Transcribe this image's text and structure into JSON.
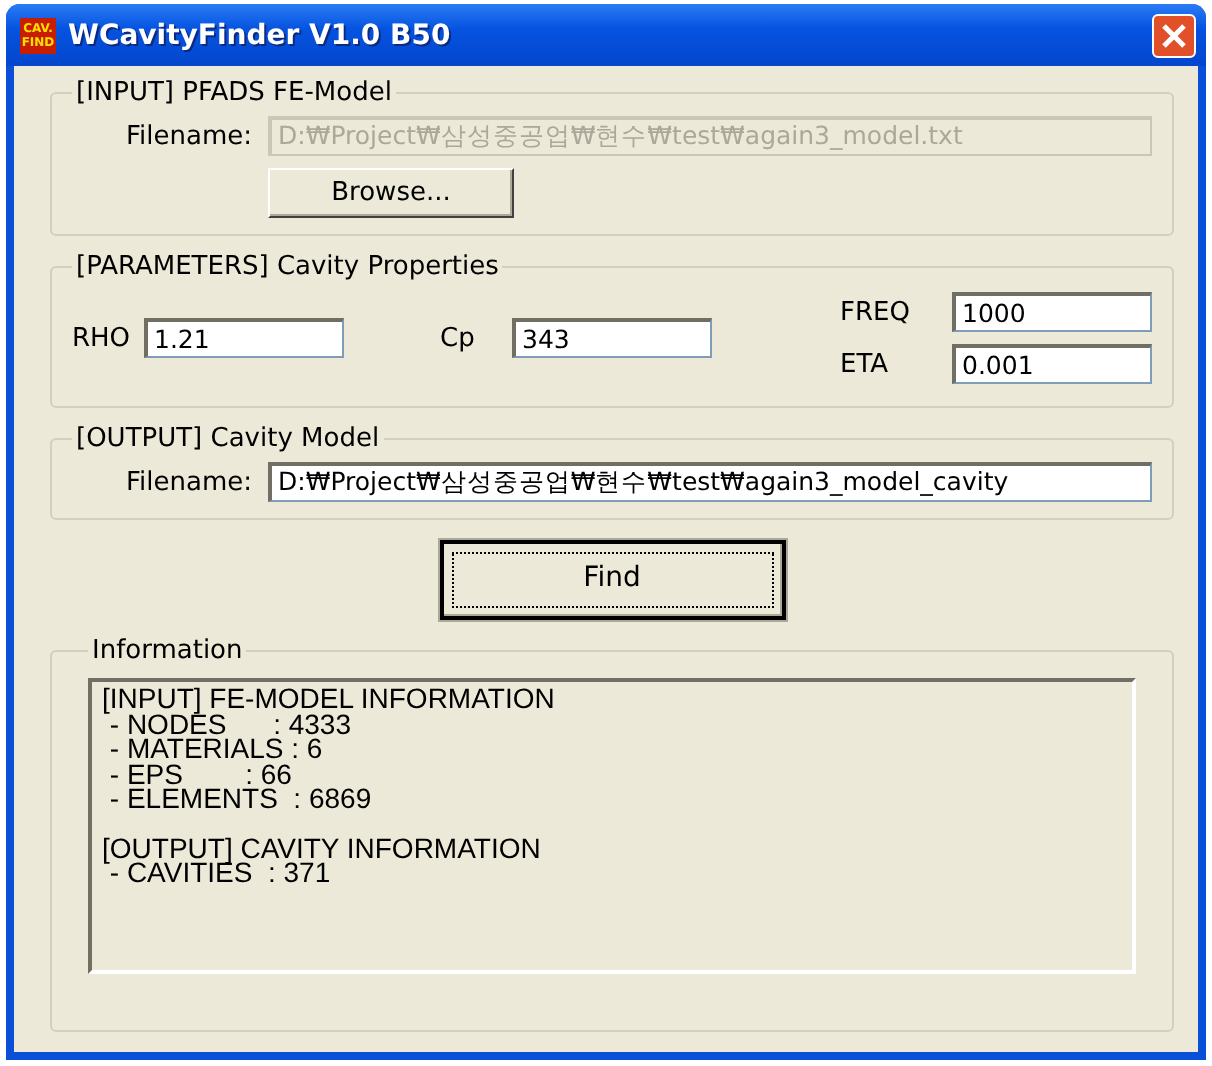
{
  "window": {
    "title": "WCavityFinder V1.0 B50",
    "icon_text": [
      "CAV.",
      "FIND"
    ]
  },
  "input_group": {
    "title": "[INPUT] PFADS FE-Model",
    "label": "Filename:",
    "value": "D:₩Project₩삼성중공업₩현수₩test₩again3_model.txt",
    "disabled": true,
    "button": "Browse..."
  },
  "parameters": {
    "title": "[PARAMETERS] Cavity Properties",
    "fields": [
      {
        "label": "RHO",
        "value": "1.21"
      },
      {
        "label": "Cp",
        "value": "343"
      },
      {
        "label": "FREQ",
        "value": "1000"
      },
      {
        "label": "ETA",
        "value": "0.001"
      }
    ]
  },
  "output_group": {
    "title": "[OUTPUT] Cavity Model",
    "label": "Filename:",
    "value": "D:₩Project₩삼성중공업₩현수₩test₩again3_model_cavity",
    "disabled": false
  },
  "find_button": {
    "label": "Find",
    "default": true
  },
  "information": {
    "title": "Information",
    "sections": [
      {
        "heading": "[INPUT] FE-MODEL INFORMATION",
        "lines": [
          " - NODES      : 4333",
          " - MATERIALS : 6",
          " - EPS        : 66",
          " - ELEMENTS  : 6869"
        ]
      },
      {
        "heading": "[OUTPUT] CAVITY INFORMATION",
        "lines": [
          " - CAVITIES  : 371"
        ]
      }
    ]
  }
}
